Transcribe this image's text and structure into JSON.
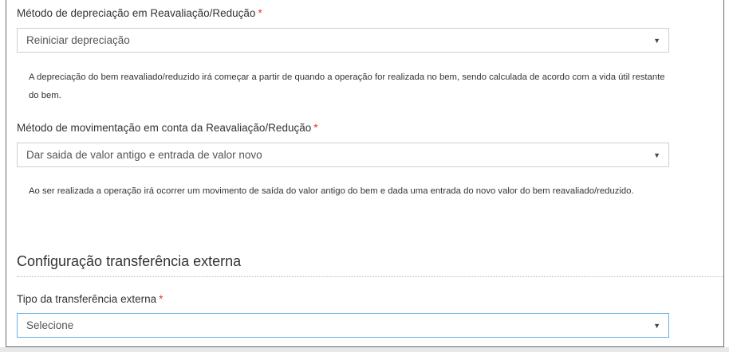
{
  "fields": [
    {
      "label": "Método de depreciação em Reavaliação/Redução",
      "required_mark": "*",
      "value": "Reiniciar depreciação",
      "help": "A depreciação do bem reavaliado/reduzido irá começar a partir de quando a operação for realizada no bem, sendo calculada de acordo com a vida útil restante do bem."
    },
    {
      "label": "Método de movimentação em conta da Reavaliação/Redução",
      "required_mark": "*",
      "value": "Dar saida de valor antigo e entrada de valor novo",
      "help": "Ao ser realizada a operação irá ocorrer um movimento de saída do valor antigo do bem e dada uma entrada do novo valor do bem reavaliado/reduzido."
    }
  ],
  "section": {
    "title": "Configuração transferência externa",
    "field": {
      "label": "Tipo da transferência externa",
      "required_mark": "*",
      "value": "Selecione"
    }
  },
  "icons": {
    "dropdown": "caret-down-icon"
  },
  "colors": {
    "required": "#e3342f",
    "focus_border": "#66afe9"
  }
}
